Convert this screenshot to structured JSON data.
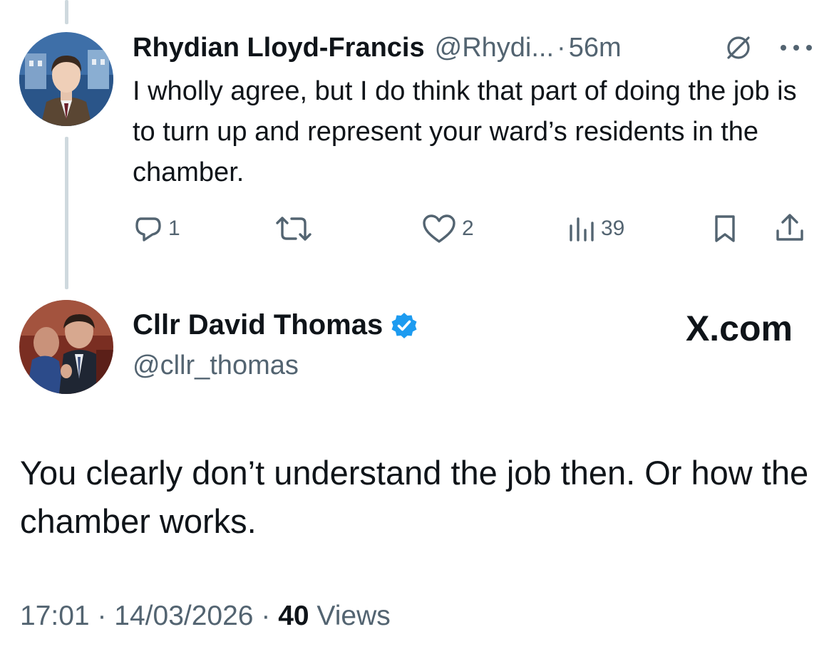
{
  "reply": {
    "name": "Rhydian Lloyd-Francis",
    "handle": "@Rhydi...",
    "separator": "·",
    "time": "56m",
    "text": "I wholly agree, but I do think that part of doing the job is to turn up and represent your ward’s residents in the chamber.",
    "actions": {
      "replies": "1",
      "likes": "2",
      "views": "39"
    },
    "icons": [
      "grok-icon",
      "more-icon",
      "reply-icon",
      "retweet-icon",
      "like-icon",
      "views-icon",
      "bookmark-icon",
      "share-icon"
    ]
  },
  "main": {
    "name": "Cllr David Thomas",
    "handle": "@cllr_thomas",
    "watermark": "X.com",
    "text": "You clearly don’t understand the job then. Or how the chamber works.",
    "timestamp": "17:01",
    "date": "14/03/2026",
    "separator": "·",
    "views_count": "40",
    "views_label": "Views"
  },
  "colors": {
    "text": "#0f1419",
    "secondary": "#536471",
    "verified": "#1d9bf0",
    "thread_line": "#cfd9de"
  }
}
